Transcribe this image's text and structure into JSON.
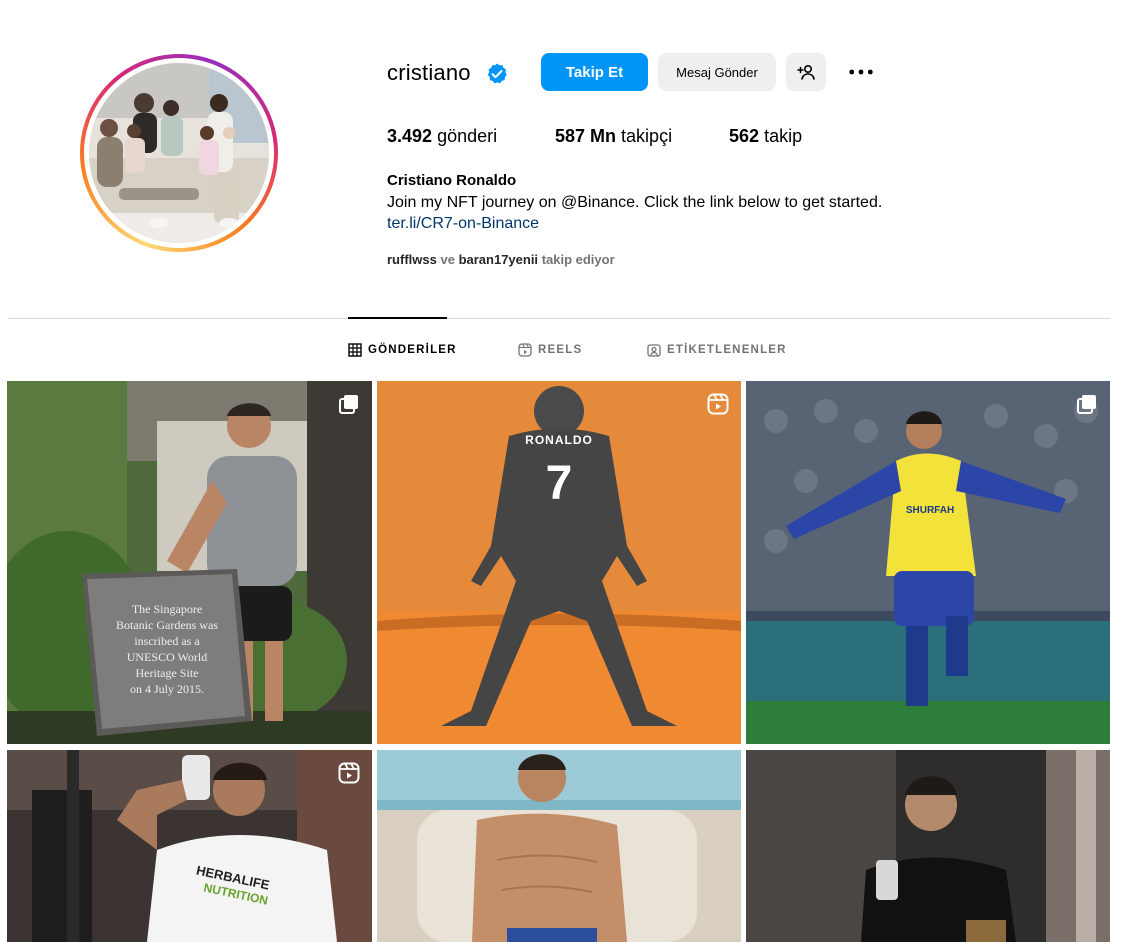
{
  "profile": {
    "username": "cristiano",
    "actions": {
      "follow_label": "Takip Et",
      "message_label": "Mesaj Gönder"
    },
    "stats": {
      "posts_count": "3.492",
      "posts_label": "gönderi",
      "followers_count": "587 Mn",
      "followers_label": "takipçi",
      "following_count": "562",
      "following_label": "takip"
    },
    "full_name": "Cristiano Ronaldo",
    "bio": "Join my NFT journey on @Binance. Click the link below to get started.",
    "link": "ter.li/CR7-on-Binance",
    "followed_by": {
      "user1": "rufflwss",
      "joiner": "ve",
      "user2": "baran17yenii",
      "suffix": "takip ediyor"
    }
  },
  "tabs": [
    {
      "label": "GÖNDERİLER",
      "icon": "grid-icon",
      "active": true
    },
    {
      "label": "REELS",
      "icon": "reels-icon",
      "active": false
    },
    {
      "label": "ETİKETLENENLER",
      "icon": "tagged-icon",
      "active": false
    }
  ],
  "posts": [
    {
      "type": "carousel",
      "badge_icon": "carousel-icon",
      "plaque_text": "The Singapore Botanic Gardens was inscribed as a UNESCO World Heritage Site on 4 July 2015."
    },
    {
      "type": "reel",
      "badge_icon": "reels-icon",
      "shirt_name": "RONALDO",
      "shirt_number": "7"
    },
    {
      "type": "carousel",
      "badge_icon": "carousel-icon",
      "sponsor": "SHURFAH"
    },
    {
      "type": "reel",
      "badge_icon": "reels-icon",
      "brand_text": "HERBALIFE NUTRITION"
    },
    {
      "type": "image"
    },
    {
      "type": "image"
    }
  ],
  "colors": {
    "primary": "#0095f6",
    "secondary_button": "#efefef",
    "link": "#00376b",
    "muted": "#737373",
    "divider": "#dbdbdb",
    "verified": "#0095f6"
  }
}
